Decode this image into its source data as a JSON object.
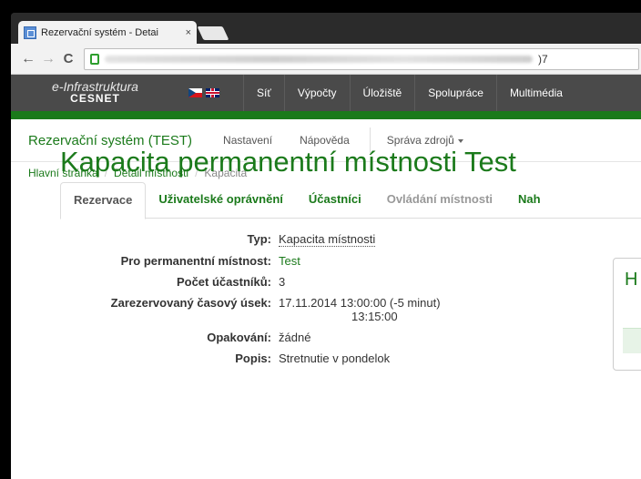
{
  "browser": {
    "tab_title": "Rezervační systém - Detai",
    "tab_close": "×",
    "back": "←",
    "forward": "→",
    "reload": "C",
    "url_tail": ")7"
  },
  "cesnet": {
    "brand_line1": "e-Infrastruktura",
    "brand_line2": "CESNET",
    "nav": [
      "Síť",
      "Výpočty",
      "Úložiště",
      "Spolupráce",
      "Multimédia"
    ]
  },
  "app": {
    "title": "Rezervační systém (TEST)",
    "nav_settings": "Nastavení",
    "nav_help": "Nápověda",
    "nav_resources": "Správa zdrojů"
  },
  "breadcrumb": {
    "home": "Hlavní stránka",
    "detail": "Detail místnosti",
    "current": "Kapacita",
    "sep": "/"
  },
  "page": {
    "heading": "Kapacita permanentní místnosti Test",
    "tabs": [
      "Rezervace",
      "Uživatelské oprávnění",
      "Účastníci",
      "Ovládání místnosti",
      "Nah"
    ],
    "details": {
      "type_label": "Typ:",
      "type_value": "Kapacita místnosti",
      "room_label": "Pro permanentní místnost:",
      "room_value": "Test",
      "participants_label": "Počet účastníků:",
      "participants_value": "3",
      "slot_label": "Zarezervovaný časový úsek:",
      "slot_value_line1": "17.11.2014 13:00:00 (-5 minut)",
      "slot_value_line2": "13:15:00",
      "repeat_label": "Opakování:",
      "repeat_value": "žádné",
      "desc_label": "Popis:",
      "desc_value": "Stretnutie v pondelok"
    },
    "side_panel_letter": "H"
  }
}
